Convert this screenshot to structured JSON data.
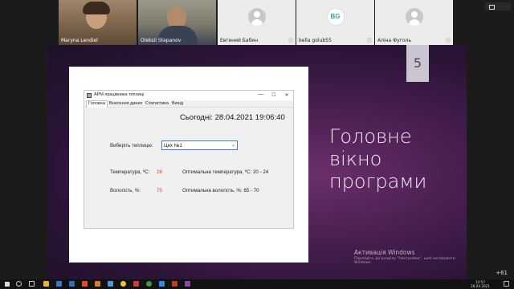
{
  "participants": [
    {
      "name": "Maryna Lendiel",
      "kind": "video"
    },
    {
      "name": "Oleksii Stepanov",
      "kind": "video"
    },
    {
      "name": "Евгений Бабин",
      "kind": "avatar"
    },
    {
      "name": "bella golub55",
      "kind": "initials",
      "initials": "BG"
    },
    {
      "name": "Аліна Фуголь",
      "kind": "avatar"
    }
  ],
  "slide": {
    "number": "5",
    "title_lines": [
      "Головне",
      "вікно",
      "програми"
    ]
  },
  "app": {
    "window_title": "АРМ працівника теплиці",
    "minimize": "—",
    "maximize": "☐",
    "close": "✕",
    "menu": [
      "Головна",
      "Внесення даних",
      "Статистика",
      "Вихід"
    ],
    "today_label": "Сьогодні:",
    "today_value": "28.04.2021 19:06:40",
    "choose_label": "Виберіть теплицю:",
    "greenhouse_selected": "Цех №1",
    "temperature_label": "Температура, ºС:",
    "temperature_value": "28",
    "optimal_temperature": "Оптимальна температура, ºС: 20 - 24",
    "humidity_label": "Вологість, %:",
    "humidity_value": "75",
    "optimal_humidity": "Оптимальна вологість, %: 65 - 70"
  },
  "watermark": {
    "line1": "Активація Windows",
    "line2": "Перейдіть до розділу \"Настройки\", щоб активувати Windows."
  },
  "taskbar": {
    "time": "12:57",
    "date": "28.04.2021",
    "extra_count": "+61"
  },
  "colors": {
    "accent_red": "#e03b2e",
    "slide_purple": "#4a1f52"
  }
}
